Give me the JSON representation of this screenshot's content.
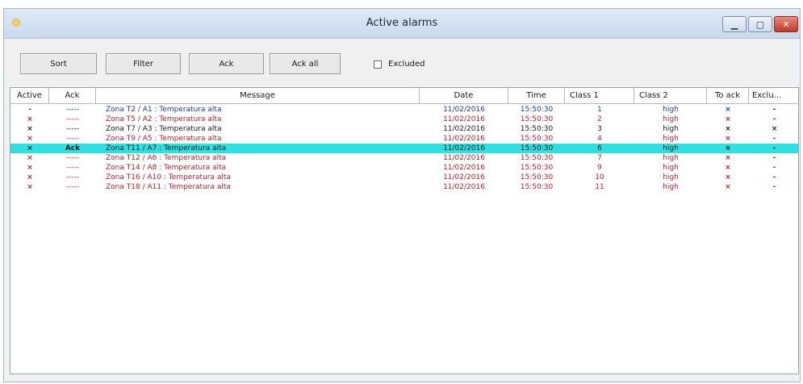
{
  "window": {
    "title": "Active alarms"
  },
  "toolbar": {
    "sort": "Sort",
    "filter": "Filter",
    "ack": "Ack",
    "ack_all": "Ack all",
    "excluded_label": "Excluded"
  },
  "columns": {
    "active": "Active",
    "ack": "Ack",
    "message": "Message",
    "date": "Date",
    "time": "Time",
    "class1": "Class 1",
    "class2": "Class 2",
    "to_ack": "To ack",
    "excluded": "Exclu..."
  },
  "colors": {
    "blue": "#1f3aa0",
    "red": "#b5232a",
    "black": "#1a1a1a",
    "selection": "#2fe0e0"
  },
  "rows": [
    {
      "active": "-",
      "ack": "-----",
      "message": "Zona T2 / A1 : Temperatura alta",
      "date": "11/02/2016",
      "time": "15:50:30",
      "class1": "1",
      "class2": "high",
      "to_ack": "×",
      "excluded": "-",
      "color": "#1f3aa0",
      "selected": false
    },
    {
      "active": "×",
      "ack": "-----",
      "message": "Zona T5 / A2 : Temperatura alta",
      "date": "11/02/2016",
      "time": "15:50:30",
      "class1": "2",
      "class2": "high",
      "to_ack": "×",
      "excluded": "-",
      "color": "#b5232a",
      "selected": false
    },
    {
      "active": "×",
      "ack": "-----",
      "message": "Zona T7 / A3 : Temperatura alta",
      "date": "11/02/2016",
      "time": "15:50:30",
      "class1": "3",
      "class2": "high",
      "to_ack": "×",
      "excluded": "×",
      "color": "#1a1a1a",
      "selected": false
    },
    {
      "active": "×",
      "ack": "-----",
      "message": "Zona T9 / A5 : Temperatura alta",
      "date": "11/02/2016",
      "time": "15:50:30",
      "class1": "4",
      "class2": "high",
      "to_ack": "×",
      "excluded": "-",
      "color": "#b5232a",
      "selected": false
    },
    {
      "active": "×",
      "ack": "Ack",
      "message": "Zona T11 / A7 : Temperatura alta",
      "date": "11/02/2016",
      "time": "15:50:30",
      "class1": "6",
      "class2": "high",
      "to_ack": "×",
      "excluded": "-",
      "color": "#1a1a1a",
      "selected": true
    },
    {
      "active": "×",
      "ack": "-----",
      "message": "Zona T12 / A6 : Temperatura alta",
      "date": "11/02/2016",
      "time": "15:50:30",
      "class1": "7",
      "class2": "high",
      "to_ack": "×",
      "excluded": "-",
      "color": "#b5232a",
      "selected": false
    },
    {
      "active": "×",
      "ack": "-----",
      "message": "Zona T14 / A8 : Temperatura alta",
      "date": "11/02/2016",
      "time": "15:50:30",
      "class1": "9",
      "class2": "high",
      "to_ack": "×",
      "excluded": "-",
      "color": "#b5232a",
      "selected": false
    },
    {
      "active": "×",
      "ack": "-----",
      "message": "Zona T16 / A10 : Temperatura alta",
      "date": "11/02/2016",
      "time": "15:50:30",
      "class1": "10",
      "class2": "high",
      "to_ack": "×",
      "excluded": "-",
      "color": "#b5232a",
      "selected": false
    },
    {
      "active": "×",
      "ack": "-----",
      "message": "Zona T18 / A11 : Temperatura alta",
      "date": "11/02/2016",
      "time": "15:50:30",
      "class1": "11",
      "class2": "high",
      "to_ack": "×",
      "excluded": "-",
      "color": "#b5232a",
      "selected": false
    }
  ]
}
